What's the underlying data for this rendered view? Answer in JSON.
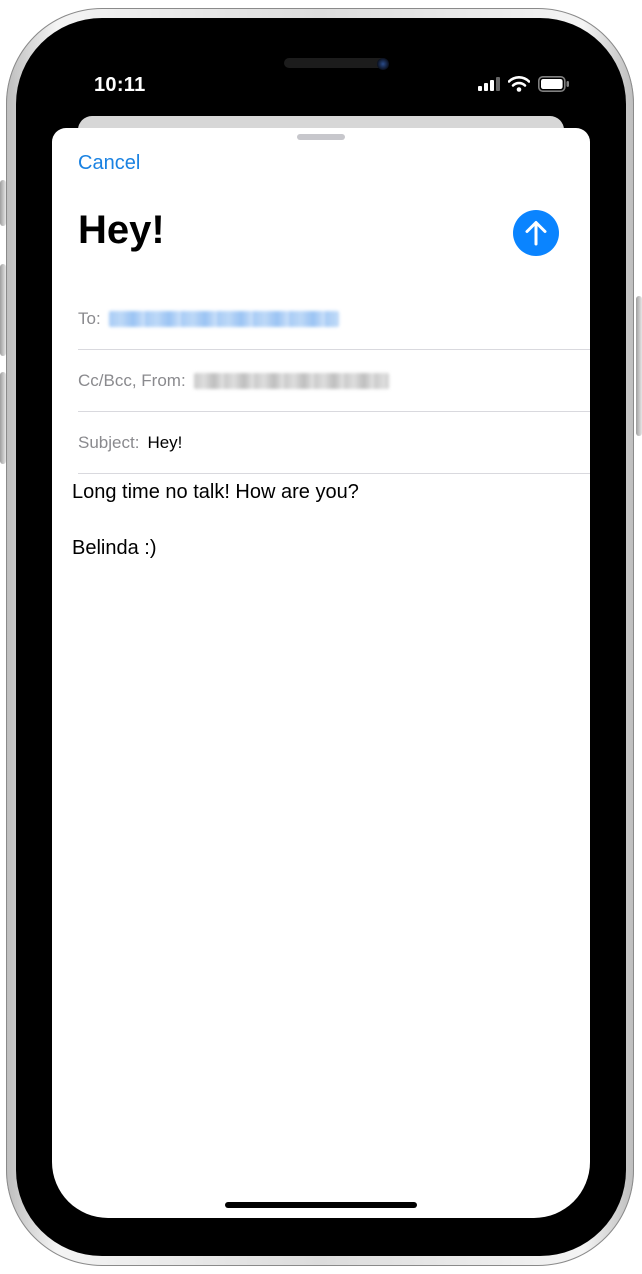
{
  "status_bar": {
    "time": "10:11",
    "icons": [
      "cellular-signal-icon",
      "wifi-icon",
      "battery-icon"
    ]
  },
  "compose": {
    "cancel_label": "Cancel",
    "title": "Hey!",
    "send_icon": "arrow-up-icon",
    "to_label": "To:",
    "cc_from_label": "Cc/Bcc, From:",
    "subject_label": "Subject:",
    "subject_value": "Hey!",
    "body_lines": [
      "Long time no talk! How are you?",
      "Belinda :)"
    ]
  },
  "colors": {
    "accent": "#0a84ff",
    "link": "#1a82e2",
    "label_gray": "#8a8a8e",
    "separator": "#d9d9de"
  }
}
